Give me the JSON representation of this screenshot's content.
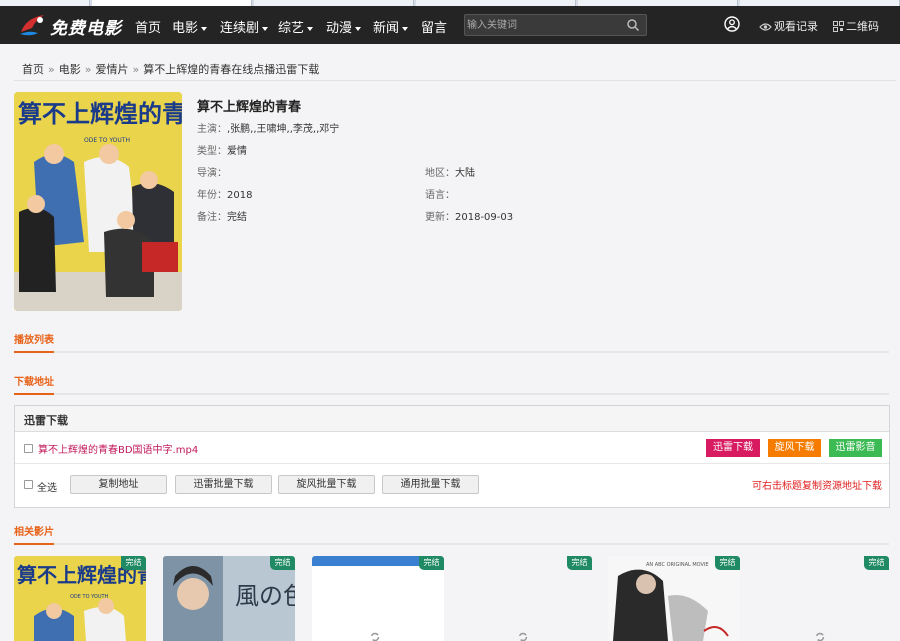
{
  "nav": {
    "brand": "免费电影",
    "items": [
      {
        "label": "首页",
        "dropdown": false
      },
      {
        "label": "电影",
        "dropdown": true
      },
      {
        "label": "连续剧",
        "dropdown": true
      },
      {
        "label": "综艺",
        "dropdown": true
      },
      {
        "label": "动漫",
        "dropdown": true
      },
      {
        "label": "新闻",
        "dropdown": true
      },
      {
        "label": "留言",
        "dropdown": false
      }
    ],
    "search_placeholder": "输入关键词",
    "history_label": "观看记录",
    "qrcode_label": "二维码"
  },
  "breadcrumb": {
    "home": "首页",
    "movie": "电影",
    "category": "爱情片",
    "current": "算不上辉煌的青春在线点播迅雷下载",
    "separator": "»"
  },
  "movie": {
    "title": "算不上辉煌的青春",
    "cast_label": "主演：",
    "cast": ",张鹏,,王啸坤,,李茂,,邓宁",
    "genre_label": "类型：",
    "genre": "爱情",
    "director_label": "导演：",
    "director": "",
    "region_label": "地区：",
    "region": "大陆",
    "year_label": "年份：",
    "year": "2018",
    "language_label": "语言：",
    "language": "",
    "note_label": "备注：",
    "note": "完结",
    "updated_label": "更新：",
    "updated": "2018-09-03",
    "poster": {
      "title_text": "算不上辉煌的青春",
      "subtitle_text": "ODE TO YOUTH"
    }
  },
  "sections": {
    "playlist": "播放列表",
    "download": "下载地址",
    "related": "相关影片"
  },
  "download": {
    "box_title": "迅雷下载",
    "file_name": "算不上辉煌的青春BD国语中字.mp4",
    "buttons": [
      {
        "label": "迅雷下载",
        "color": "#d81b60"
      },
      {
        "label": "旋风下载",
        "color": "#f57c00"
      },
      {
        "label": "迅雷影音",
        "color": "#3cba54"
      }
    ],
    "select_all": "全选",
    "batch_buttons": [
      "复制地址",
      "迅雷批量下载",
      "旋风批量下载",
      "通用批量下载"
    ],
    "hint": "可右击标题复制资源地址下载"
  },
  "related": [
    {
      "badge": "完结",
      "poster_text": "算不上辉煌的青春",
      "poster_sub": "ODE TO YOUTH"
    },
    {
      "badge": "完结",
      "poster_text": "風の色",
      "poster_sub": ""
    },
    {
      "badge": "完结",
      "poster_text": "",
      "poster_sub": ""
    },
    {
      "badge": "完结",
      "poster_text": "",
      "poster_sub": ""
    },
    {
      "badge": "完结",
      "poster_text": "",
      "poster_sub": "AN ABC ORIGINAL MOVIE"
    },
    {
      "badge": "完结",
      "poster_text": "",
      "poster_sub": ""
    }
  ],
  "colors": {
    "accent": "#e8631a",
    "nav_bg": "#242424",
    "badge": "#1f8a63",
    "link_red": "#c2185b",
    "hint_red": "#e02020"
  }
}
